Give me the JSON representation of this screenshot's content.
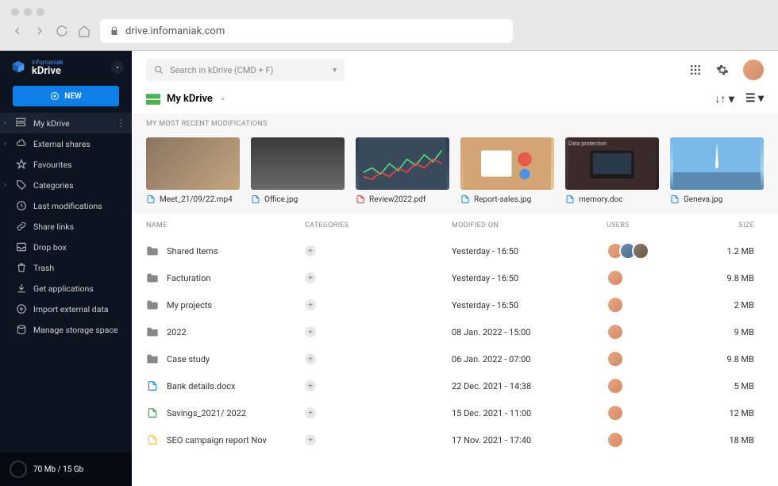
{
  "browser": {
    "url": "drive.infomaniak.com"
  },
  "brand": {
    "sub": "infomaniak",
    "name": "kDrive"
  },
  "new_btn": "NEW",
  "sidebar": [
    {
      "label": "My kDrive",
      "icon": "drive",
      "active": true,
      "expandable": true,
      "more": true
    },
    {
      "label": "External shares",
      "icon": "cloud",
      "expandable": true
    },
    {
      "label": "Favourites",
      "icon": "star"
    },
    {
      "label": "Categories",
      "icon": "tag",
      "expandable": true
    },
    {
      "label": "Last modifications",
      "icon": "clock"
    },
    {
      "label": "Share links",
      "icon": "link"
    },
    {
      "label": "Drop box",
      "icon": "inbox"
    },
    {
      "label": "Trash",
      "icon": "trash"
    },
    {
      "label": "Get applications",
      "icon": "download"
    },
    {
      "label": "Import external data",
      "icon": "plus-circle"
    },
    {
      "label": "Manage storage space",
      "icon": "disk"
    }
  ],
  "storage": "70 Mb / 15 Gb",
  "search_placeholder": "Search in kDrive (CMD + F)",
  "breadcrumb": "My kDrive",
  "section_label": "MY MOST RECENT MODIFICATIONS",
  "thumbs": [
    {
      "name": "Meet_21/09/22.mp4",
      "type": "video",
      "thumb": "office1"
    },
    {
      "name": "Office.jpg",
      "type": "image",
      "thumb": "office2"
    },
    {
      "name": "Review2022.pdf",
      "type": "pdf",
      "thumb": "chart"
    },
    {
      "name": "Report-sales.jpg",
      "type": "image",
      "thumb": "desk"
    },
    {
      "name": "memory.doc",
      "type": "doc",
      "thumb": "laptop",
      "badge": "Data protection"
    },
    {
      "name": "Geneva.jpg",
      "type": "image",
      "thumb": "geneva"
    }
  ],
  "columns": {
    "name": "NAME",
    "cat": "CATEGORIES",
    "mod": "MODIFIED ON",
    "users": "USERS",
    "size": "SIZE"
  },
  "rows": [
    {
      "name": "Shared Items",
      "type": "folder",
      "mod": "Yesterday - 16:50",
      "users": 3,
      "size": "1.2 MB"
    },
    {
      "name": "Facturation",
      "type": "folder",
      "mod": "Yesterday - 16:50",
      "users": 1,
      "size": "9.8 MB"
    },
    {
      "name": "My projects",
      "type": "folder",
      "mod": "Yesterday - 16:50",
      "users": 1,
      "size": "2 MB"
    },
    {
      "name": "2022",
      "type": "folder",
      "mod": "08 Jan. 2022 - 15:00",
      "users": 1,
      "size": "9 MB"
    },
    {
      "name": "Case study",
      "type": "folder",
      "mod": "06 Jan. 2022 - 07:00",
      "users": 1,
      "size": "9.8 MB"
    },
    {
      "name": "Bank details.docx",
      "type": "docx",
      "mod": "22 Dec. 2021 - 14:38",
      "users": 1,
      "size": "5 MB"
    },
    {
      "name": "Savings_2021/ 2022",
      "type": "xlsx",
      "mod": "15 Dec. 2021 - 11:00",
      "users": 1,
      "size": "12 MB"
    },
    {
      "name": "SEO campaign report Nov",
      "type": "gdoc",
      "mod": "17 Nov. 2021 - 17:40",
      "users": 1,
      "size": "18 MB"
    }
  ]
}
